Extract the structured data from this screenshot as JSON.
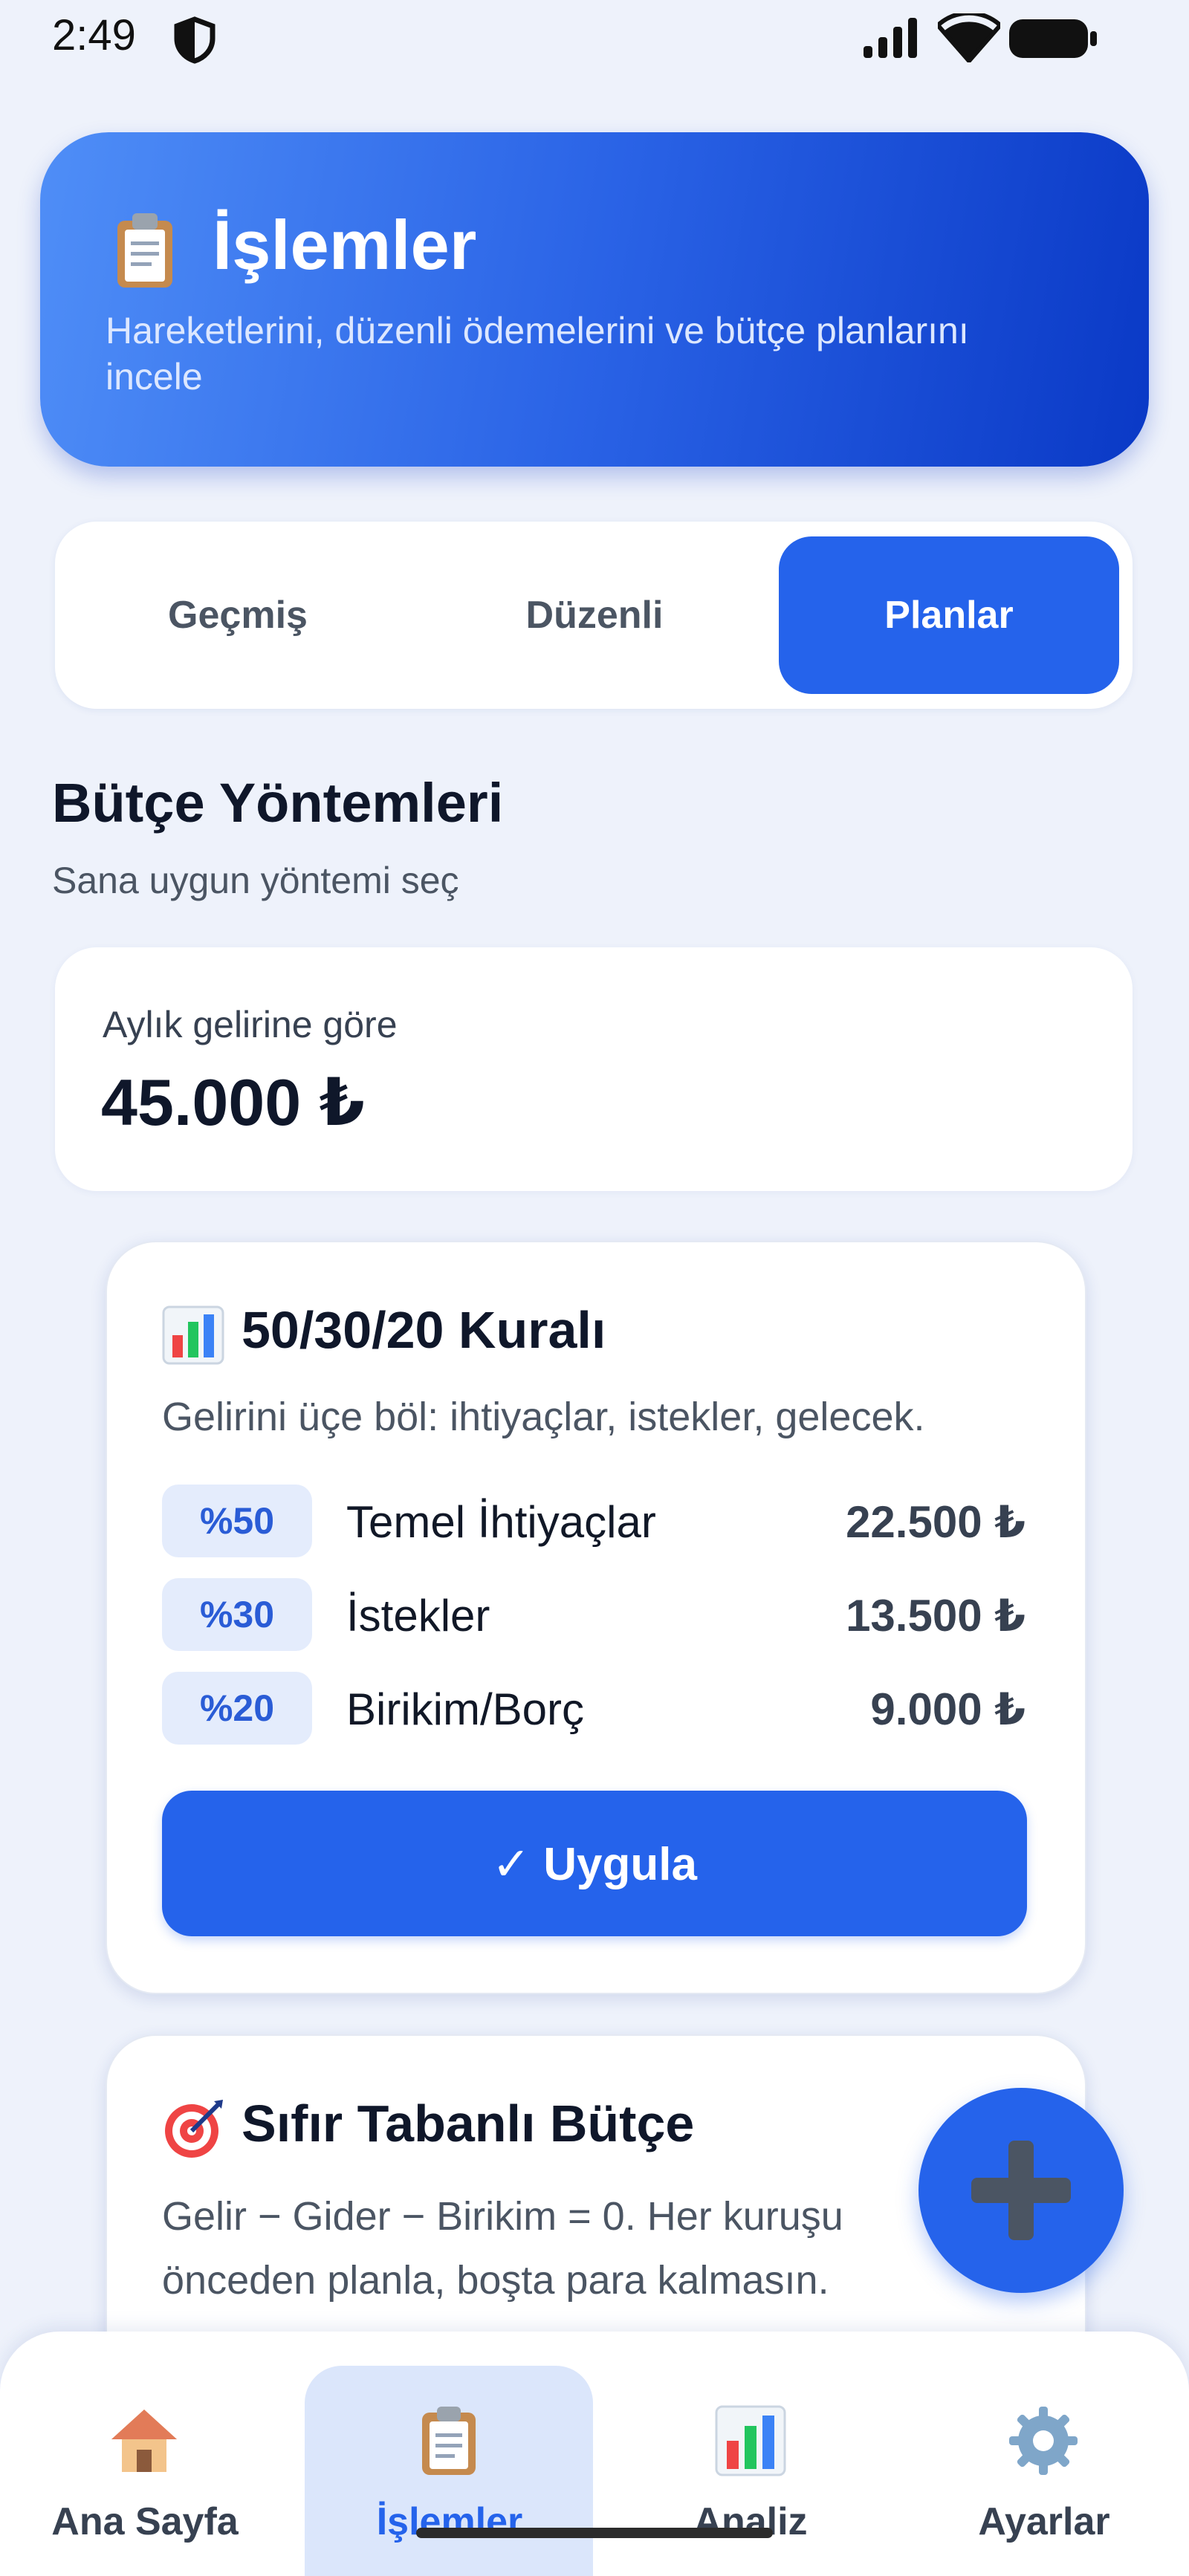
{
  "status_bar": {
    "time": "2:49"
  },
  "header": {
    "title": "İşlemler",
    "subtitle": "Hareketlerini, düzenli ödemelerini ve bütçe planlarını incele",
    "icon": "clipboard-icon",
    "gradient_colors": [
      "#4f8ef7",
      "#0a39c6"
    ]
  },
  "tabs": [
    {
      "label": "Geçmiş",
      "active": false
    },
    {
      "label": "Düzenli",
      "active": false
    },
    {
      "label": "Planlar",
      "active": true
    }
  ],
  "section": {
    "title": "Bütçe Yöntemleri",
    "subtitle": "Sana uygun yöntemi seç"
  },
  "income": {
    "label": "Aylık gelirine göre",
    "value": "45.000 ₺"
  },
  "rule_card": {
    "icon": "bar-chart-icon",
    "title": "50/30/20 Kuralı",
    "description": "Gelirini üçe böl: ihtiyaçlar, istekler, gelecek.",
    "rows": [
      {
        "percent": "%50",
        "label": "Temel İhtiyaçlar",
        "amount": "22.500 ₺"
      },
      {
        "percent": "%30",
        "label": "İstekler",
        "amount": "13.500 ₺"
      },
      {
        "percent": "%20",
        "label": "Birikim/Borç",
        "amount": "9.000 ₺"
      }
    ],
    "apply_label": "✓ Uygula"
  },
  "zero_card": {
    "icon": "target-icon",
    "title": "Sıfır Tabanlı Bütçe",
    "description": "Gelir − Gider − Birikim = 0. Her kuruşu önceden planla, boşta para kalmasın."
  },
  "fab": {
    "icon": "plus-icon"
  },
  "bottom_nav": [
    {
      "label": "Ana Sayfa",
      "icon": "home-icon",
      "active": false
    },
    {
      "label": "İşlemler",
      "icon": "clipboard-icon",
      "active": true
    },
    {
      "label": "Analiz",
      "icon": "bar-chart-icon",
      "active": false
    },
    {
      "label": "Ayarlar",
      "icon": "gear-icon",
      "active": false
    }
  ],
  "colors": {
    "accent": "#2563eb",
    "background": "#eef2fb",
    "pill_bg": "#e4ecfc"
  }
}
